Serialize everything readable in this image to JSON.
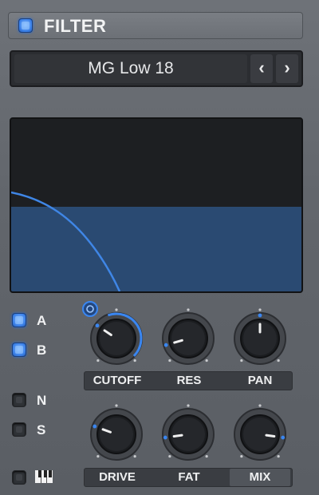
{
  "header": {
    "title": "FILTER",
    "power_on": true
  },
  "preset": {
    "name": "MG Low 18",
    "prev": "‹",
    "next": "›"
  },
  "side_buttons": [
    {
      "label": "A",
      "on": true
    },
    {
      "label": "B",
      "on": true
    },
    {
      "label": "N",
      "on": false
    },
    {
      "label": "S",
      "on": false
    }
  ],
  "knobs_top": [
    {
      "label": "CUTOFF",
      "value": 0.3,
      "mod": true
    },
    {
      "label": "RES",
      "value": 0.12
    },
    {
      "label": "PAN",
      "value": 0.5
    }
  ],
  "knobs_bottom": [
    {
      "label": "DRIVE",
      "value": 0.25
    },
    {
      "label": "FAT",
      "value": 0.15
    },
    {
      "label": "MIX",
      "value": 0.85
    }
  ],
  "colors": {
    "accent": "#3a86f0",
    "curve": "#3f86e6",
    "fill": "#2a4a72"
  }
}
